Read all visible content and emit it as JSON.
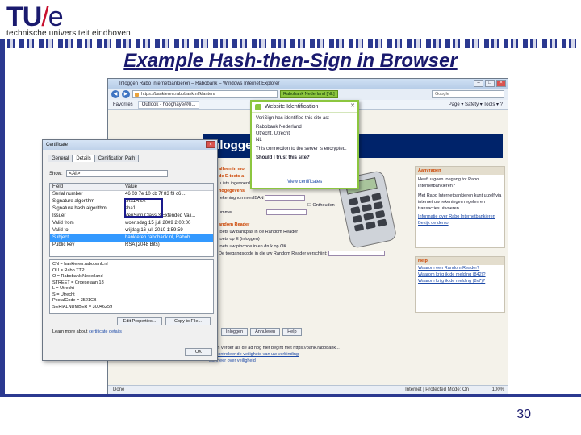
{
  "header": {
    "logo_main": "TU",
    "logo_slash": "/",
    "logo_e": "e",
    "logo_sub": "technische universiteit eindhoven",
    "slide_title": "Example Hash-then-Sign in Browser",
    "page_number": "30"
  },
  "browser": {
    "window_title": "Inloggen Rabo Internetbankieren – Rabobank – Windows Internet Explorer",
    "url": "https://bankieren.rabobank.nl/klanten/",
    "identity_badge": "Rabobank Nederland [NL]",
    "search_engine": "Google",
    "favorites": "Favorites",
    "tab_label": "Outlook - hooghaye@h...",
    "toolbar_right": "Page ▾  Safety ▾  Tools ▾  ?",
    "status_done": "Done",
    "status_zone": "Internet | Protected Mode: On",
    "status_zoom": "100%"
  },
  "identity_popup": {
    "title": "Website Identification",
    "line1": "VeriSign has identified this site as:",
    "org": "Rabobank Nederland",
    "city": "Utrecht, Utrecht",
    "country": "NL",
    "line2": "This connection to the server is encrypted.",
    "question": "Should I trust this site?",
    "link": "View certificates"
  },
  "rabo": {
    "banner": "Inloggen m",
    "heading1": "alleen in mo",
    "line_a": "de E-toets a",
    "line_b": "u iets ingevoerd,  zorgt dan",
    "label_gegevens": "ndgegevens",
    "label_rekening": "rekeningnummer/IBAN",
    "label_onthouden": "Onthouden",
    "label_nummer": "ummer",
    "heading2": "andom Reader",
    "step1": "toets uw bankpas in de Random Reader",
    "step2": "toets op E (inloggen)",
    "step3": "toets uw pincode in en druk op OK",
    "step4": "De toegangscode in die uw Random Reader verschijnt:",
    "btn_login": "Inloggen",
    "btn_cancel": "Annuleren",
    "btn_help": "Help",
    "foot1": "u kan verder als de ad nog niet begint met https://bank.rabobank...",
    "foot2": "uw controleer de veiligheid van uw verbinding",
    "foot3": "uw meer over veiligheid",
    "side1_head": "Aanvragen",
    "side1_text": "Heeft u geen toegang tot Rabo Internetbankieren?",
    "side1_text2": "Met Rabo Internetbankieren kunt u zelf via internet uw rekeningen regelen en transacties uitvoeren.",
    "side1_link1": "Informatie over Rabo Internetbankieren",
    "side1_link2": "Bekijk de demo",
    "side2_head": "Help",
    "side2_link1": "Waarom een Random Reader?",
    "side2_link2": "Waarom krijg ik de melding (842)?",
    "side2_link3": "Waarom krijg ik de melding (8x7)?"
  },
  "cert": {
    "title": "Certificate",
    "tab_general": "General",
    "tab_details": "Details",
    "tab_path": "Certification Path",
    "show_label": "Show:",
    "show_value": "<All>",
    "col_field": "Field",
    "col_value": "Value",
    "rows": [
      {
        "field": "Serial number",
        "value": "46 03 7e 10 cb 7f 83 f3 c6 ..."
      },
      {
        "field": "Signature algorithm",
        "value": "sha1RSA"
      },
      {
        "field": "Signature hash algorithm",
        "value": "sha1"
      },
      {
        "field": "Issuer",
        "value": "VeriSign Class 3 Extended Vali..."
      },
      {
        "field": "Valid from",
        "value": "woensdag 15 juli 2009 2:00:00"
      },
      {
        "field": "Valid to",
        "value": "vrijdag 16 juli 2010 1:59:59"
      },
      {
        "field": "Subject",
        "value": "bankieren.rabobank.nl, Rabob..."
      },
      {
        "field": "Public key",
        "value": "RSA (2048 Bits)"
      }
    ],
    "detail_lines": [
      "CN = bankieren.rabobank.nl",
      "OU = Rabo TTP",
      "O = Rabobank Nederland",
      "STREET = Croeselaan 18",
      "L = Utrecht",
      "S = Utrecht",
      "PostalCode = 3521CB",
      "SERIALNUMBER = 30046259"
    ],
    "btn_edit": "Edit Properties...",
    "btn_copy": "Copy to File...",
    "learn_text": "Learn more about",
    "learn_link": "certificate details",
    "btn_ok": "OK"
  }
}
